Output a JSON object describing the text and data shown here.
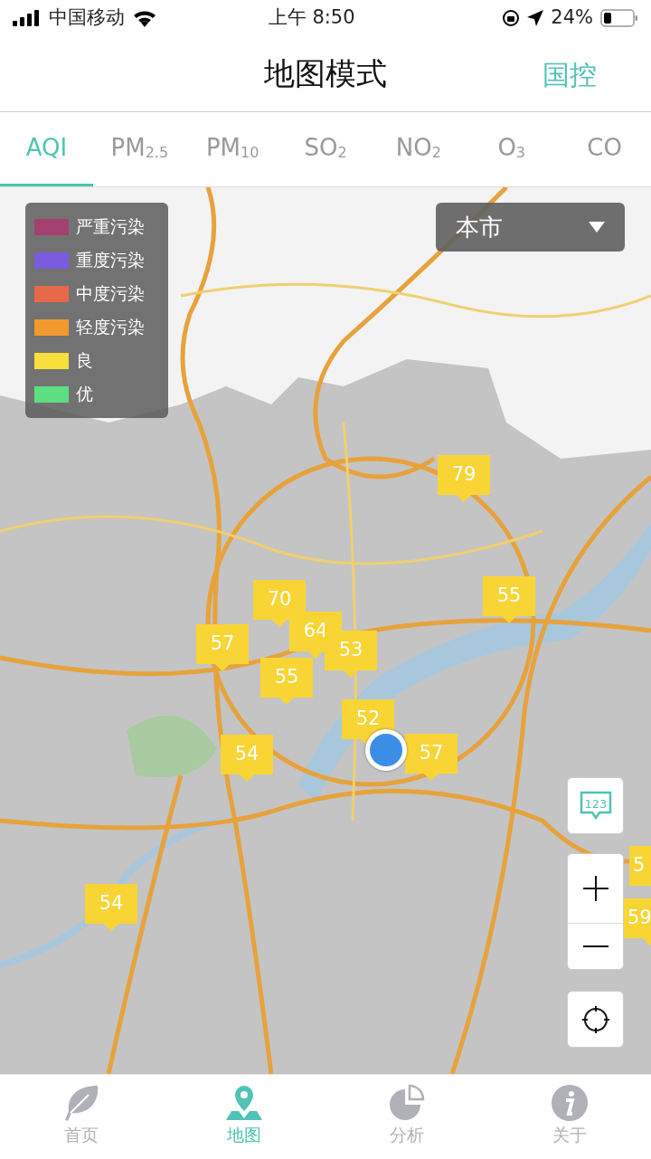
{
  "status_bar": {
    "carrier": "中国移动",
    "time": "上午 8:50",
    "battery": "24%"
  },
  "header": {
    "title": "地图模式",
    "action": "国控"
  },
  "tabs": [
    {
      "label": "AQI",
      "selected": true
    },
    {
      "label": "PM$_{2.5}$",
      "selected": false
    },
    {
      "label": "PM$_{10}$",
      "selected": false
    },
    {
      "label": "SO$_{2}$",
      "selected": false
    },
    {
      "label": "NO$_{2}$",
      "selected": false
    },
    {
      "label": "O$_{3}$",
      "selected": false
    },
    {
      "label": "CO",
      "selected": false
    }
  ],
  "legend": [
    {
      "label": "严重污染",
      "color": "#a3406f"
    },
    {
      "label": "重度污染",
      "color": "#7b5ce0"
    },
    {
      "label": "中度污染",
      "color": "#e8684a"
    },
    {
      "label": "轻度污染",
      "color": "#f39a2e"
    },
    {
      "label": "良",
      "color": "#f7e03c"
    },
    {
      "label": "优",
      "color": "#5ede82"
    }
  ],
  "region_dropdown": {
    "value": "本市"
  },
  "markers": [
    {
      "value": "79"
    },
    {
      "value": "55"
    },
    {
      "value": "70"
    },
    {
      "value": "64"
    },
    {
      "value": "53"
    },
    {
      "value": "57"
    },
    {
      "value": "55"
    },
    {
      "value": "52"
    },
    {
      "value": "57"
    },
    {
      "value": "54"
    },
    {
      "value": "54"
    },
    {
      "value": "5"
    },
    {
      "value": "59"
    }
  ],
  "map_controls": {
    "label_toggle": "123"
  },
  "bottom_nav": [
    {
      "label": "首页",
      "selected": false
    },
    {
      "label": "地图",
      "selected": true
    },
    {
      "label": "分析",
      "selected": false
    },
    {
      "label": "关于",
      "selected": false
    }
  ]
}
